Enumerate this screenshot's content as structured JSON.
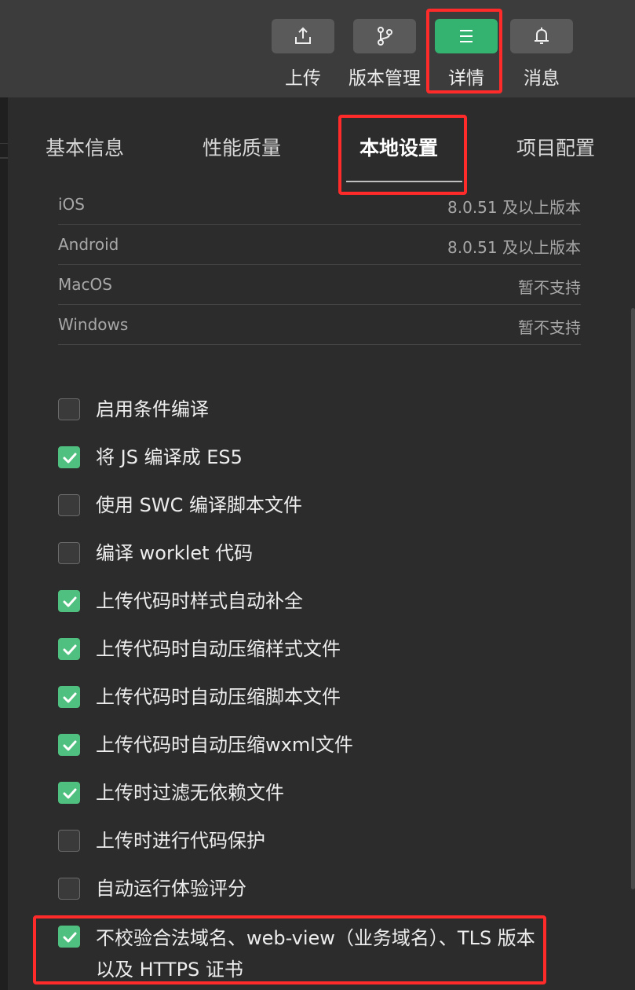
{
  "toolbar": {
    "upload": "上传",
    "version": "版本管理",
    "detail": "详情",
    "message": "消息"
  },
  "tabs": [
    "基本信息",
    "性能质量",
    "本地设置",
    "项目配置"
  ],
  "active_tab": "本地设置",
  "platforms": [
    {
      "name": "iOS",
      "value": "8.0.51 及以上版本"
    },
    {
      "name": "Android",
      "value": "8.0.51 及以上版本"
    },
    {
      "name": "MacOS",
      "value": "暂不支持"
    },
    {
      "name": "Windows",
      "value": "暂不支持"
    }
  ],
  "settings": [
    {
      "label": "启用条件编译",
      "checked": false
    },
    {
      "label": "将 JS 编译成 ES5",
      "checked": true
    },
    {
      "label": "使用 SWC 编译脚本文件",
      "checked": false
    },
    {
      "label": "编译 worklet 代码",
      "checked": false
    },
    {
      "label": "上传代码时样式自动补全",
      "checked": true
    },
    {
      "label": "上传代码时自动压缩样式文件",
      "checked": true
    },
    {
      "label": "上传代码时自动压缩脚本文件",
      "checked": true
    },
    {
      "label": "上传代码时自动压缩wxml文件",
      "checked": true
    },
    {
      "label": "上传时过滤无依赖文件",
      "checked": true
    },
    {
      "label": "上传时进行代码保护",
      "checked": false
    },
    {
      "label": "自动运行体验评分",
      "checked": false
    },
    {
      "label": "不校验合法域名、web-view（业务域名）、TLS 版本以及 HTTPS 证书",
      "checked": true
    }
  ],
  "colors": {
    "accent": "#33b36f",
    "checkbox_on": "#4fc07f",
    "highlight": "#ff2a2a"
  }
}
